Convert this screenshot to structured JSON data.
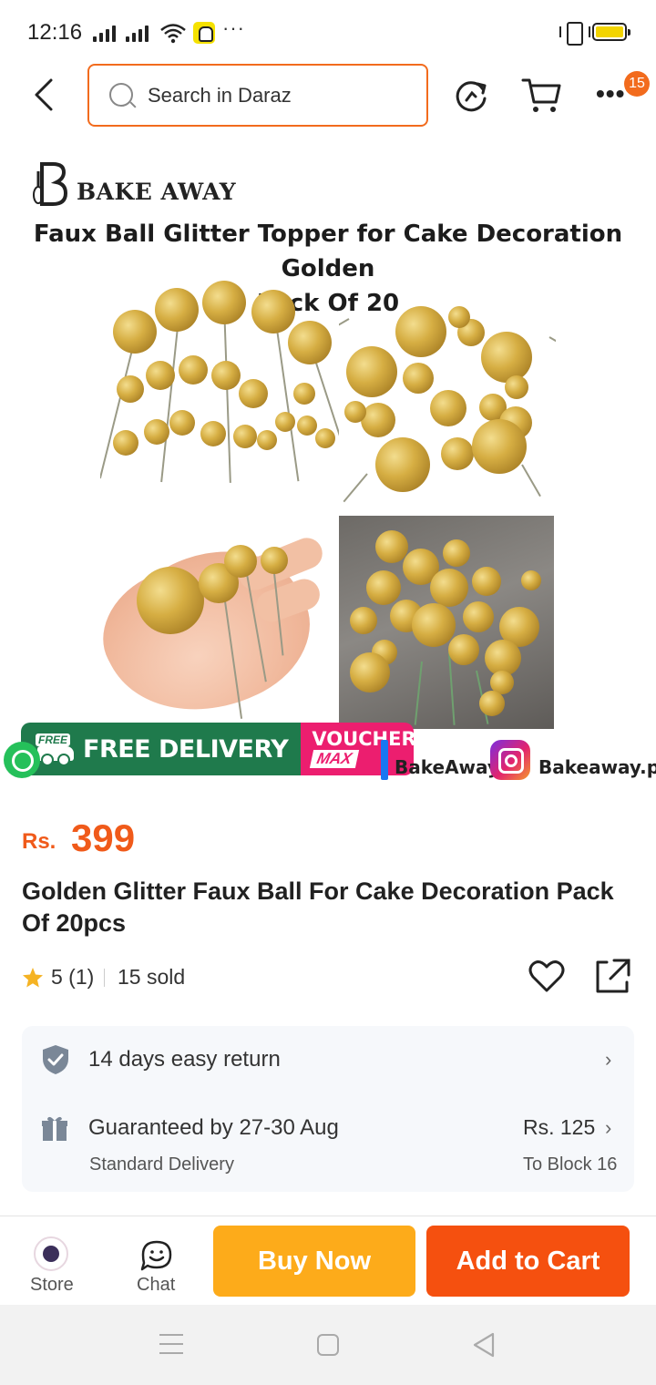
{
  "status_bar": {
    "time": "12:16",
    "more": "···"
  },
  "header": {
    "search_placeholder": "Search in Daraz",
    "cart_badge": "15",
    "icons": [
      "back-arrow-icon",
      "search-icon",
      "refresh-icon",
      "cart-icon",
      "more-icon"
    ]
  },
  "product_image": {
    "brand": "BAKE AWAY",
    "title_line1": "Faux Ball Glitter Topper for Cake Decoration Golden",
    "title_line2": "Pack Of 20",
    "promo": {
      "free_tag": "FREE",
      "free_delivery": "FREE DELIVERY",
      "voucher": "VOUCHER",
      "max": "MAX"
    },
    "social": {
      "facebook": "BakeAway",
      "instagram": "Bakeaway.pk"
    }
  },
  "product": {
    "currency": "Rs.",
    "price": "399",
    "title": "Golden Glitter Faux Ball For Cake Decoration Pack Of 20pcs",
    "rating": "5 (1)",
    "sold": "15 sold"
  },
  "info": {
    "return": "14 days easy return",
    "delivery_guarantee": "Guaranteed by 27-30 Aug",
    "delivery_type": "Standard Delivery",
    "delivery_fee": "Rs. 125",
    "delivery_dest": "To Block 16"
  },
  "actions": {
    "store": "Store",
    "chat": "Chat",
    "buy_now": "Buy Now",
    "add_to_cart": "Add to Cart"
  },
  "colors": {
    "accent": "#f05a1a",
    "buy_now": "#fdab1a",
    "add_to_cart": "#f5500f",
    "search_border": "#f26b1d"
  }
}
